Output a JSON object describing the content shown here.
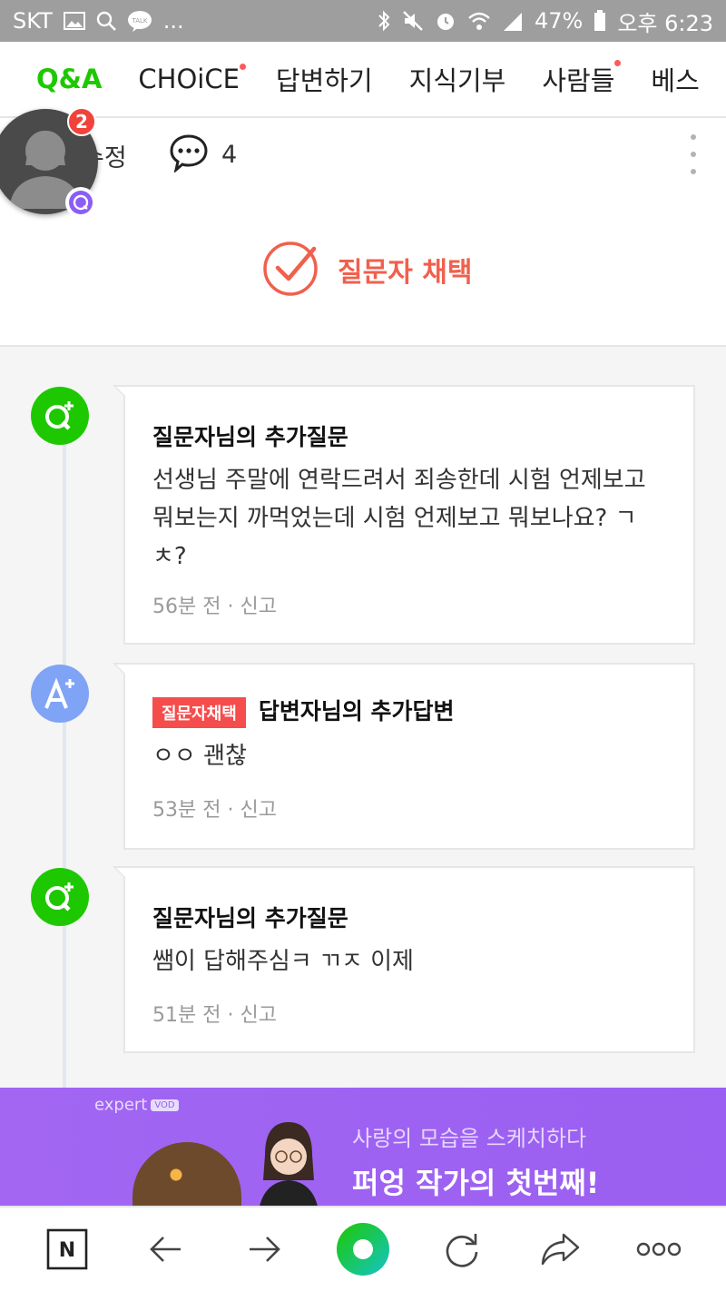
{
  "status_bar": {
    "carrier": "SKT",
    "battery": "47%",
    "time": "오후 6:23",
    "talk_label": "TALK",
    "more": "..."
  },
  "nav": {
    "tabs": [
      {
        "label": "Q&A",
        "active": true,
        "new": false
      },
      {
        "label": "CHOiCE",
        "active": false,
        "new": true
      },
      {
        "label": "답변하기",
        "active": false,
        "new": false
      },
      {
        "label": "지식기부",
        "active": false,
        "new": false
      },
      {
        "label": "사람들",
        "active": false,
        "new": true
      },
      {
        "label": "베스",
        "active": false,
        "new": false
      }
    ]
  },
  "answer_info": {
    "edit_label": "수정",
    "comment_count": "4",
    "chosen_label": "질문자 채택"
  },
  "avatar": {
    "badge_count": "2"
  },
  "threads": [
    {
      "kind": "question",
      "title": "질문자님의 추가질문",
      "body": "선생님 주말에 연락드려서 죄송한데 시험 언제보고 뭐보는지 까먹었는데 시험 언제보고 뭐보나요? ㄱㅊ?",
      "time": "56분 전",
      "report": "신고"
    },
    {
      "kind": "answer",
      "tag": "질문자채택",
      "title": "답변자님의 추가답변",
      "body": "ㅇㅇ 괜찮",
      "time": "53분 전",
      "report": "신고"
    },
    {
      "kind": "question",
      "title": "질문자님의 추가질문",
      "body": "쌤이 답해주심ㅋ ㄲㅈ 이제",
      "time": "51분 전",
      "report": "신고"
    }
  ],
  "ad": {
    "brand": "expert",
    "brand_tag": "VOD",
    "subtitle": "사랑의 모습을 스케치하다",
    "title": "퍼엉 작가의 첫번째!"
  },
  "bottom_bar": {
    "logo_letter": "N"
  },
  "colors": {
    "naver_green": "#1ec800",
    "chosen_red": "#f0604d",
    "answer_blue": "#7fa3f5",
    "ad_purple": "#a266f3"
  }
}
